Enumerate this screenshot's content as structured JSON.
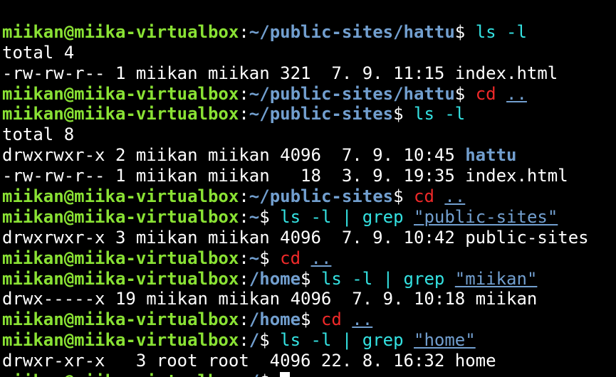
{
  "terminal": {
    "user_host": "miikan@miika-virtualbox",
    "colors": {
      "background": "#000000",
      "prompt_user": "#8ae234",
      "prompt_path": "#729fcf",
      "command": "#34e2e2",
      "command_alt": "#ef2929",
      "directory": "#729fcf",
      "text": "#ffffff"
    },
    "lines": [
      {
        "type": "prompt",
        "path": "~/public-sites/hattu",
        "cmd": "ls -l",
        "cmd_color": "cyan"
      },
      {
        "type": "output",
        "text": "total 4"
      },
      {
        "type": "output",
        "text": "-rw-rw-r-- 1 miikan miikan 321  7. 9. 11:15 index.html"
      },
      {
        "type": "prompt",
        "path": "~/public-sites/hattu",
        "cmd": "cd",
        "cmd_color": "red",
        "arg": ".."
      },
      {
        "type": "prompt",
        "path": "~/public-sites",
        "cmd": "ls -l",
        "cmd_color": "cyan"
      },
      {
        "type": "output",
        "text": "total 8"
      },
      {
        "type": "output",
        "text": "drwxrwxr-x 2 miikan miikan 4096  7. 9. 10:45 ",
        "dir": "hattu"
      },
      {
        "type": "output",
        "text": "-rw-rw-r-- 1 miikan miikan   18  3. 9. 19:35 index.html"
      },
      {
        "type": "prompt",
        "path": "~/public-sites",
        "cmd": "cd",
        "cmd_color": "red",
        "arg": ".."
      },
      {
        "type": "prompt",
        "path": "~",
        "cmd": "ls -l | grep",
        "cmd_color": "cyan",
        "arg": "\"public-sites\""
      },
      {
        "type": "output",
        "text": "drwxrwxr-x 3 miikan miikan 4096  7. 9. 10:42 public-sites"
      },
      {
        "type": "prompt",
        "path": "~",
        "cmd": "cd",
        "cmd_color": "red",
        "arg": ".."
      },
      {
        "type": "prompt",
        "path": "/home",
        "cmd": "ls -l | grep",
        "cmd_color": "cyan",
        "arg": "\"miikan\""
      },
      {
        "type": "output",
        "text": "drwx-----x 19 miikan miikan 4096  7. 9. 10:18 miikan"
      },
      {
        "type": "prompt",
        "path": "/home",
        "cmd": "cd",
        "cmd_color": "red",
        "arg": ".."
      },
      {
        "type": "prompt",
        "path": "/",
        "cmd": "ls -l | grep",
        "cmd_color": "cyan",
        "arg": "\"home\""
      },
      {
        "type": "output",
        "text": "drwxr-xr-x   3 root root  4096 22. 8. 16:32 home"
      },
      {
        "type": "prompt",
        "path": "/",
        "cmd": "",
        "cursor": true
      }
    ]
  }
}
